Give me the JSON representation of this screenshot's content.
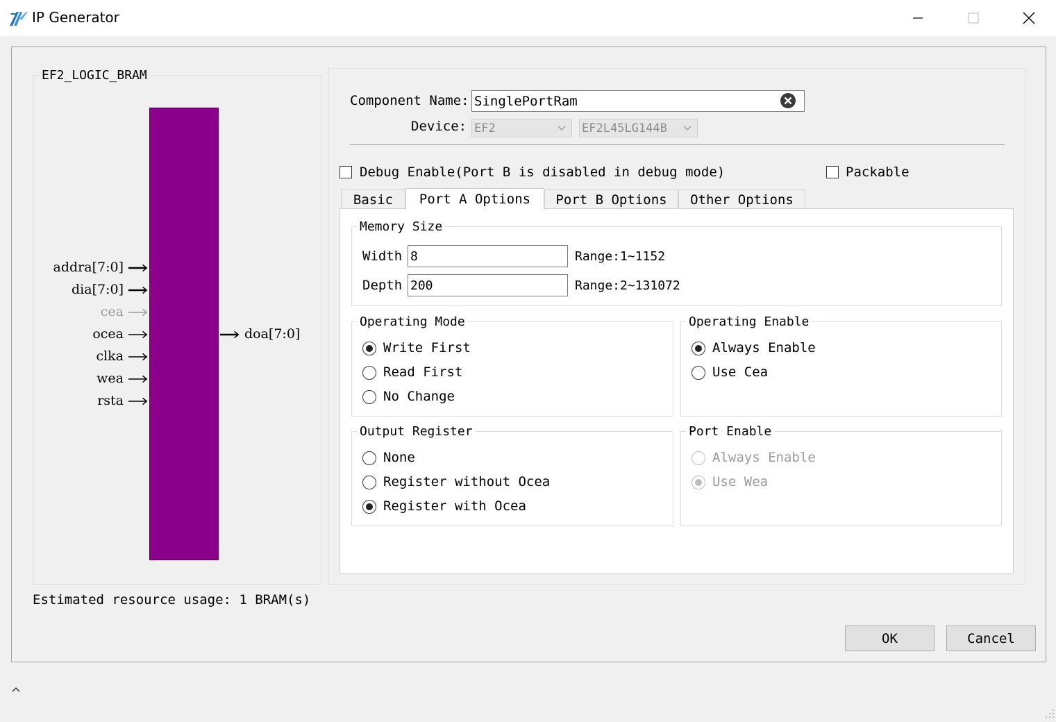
{
  "window": {
    "title": "IP Generator",
    "app_icon": "ip-generator-logo-icon"
  },
  "schematic": {
    "group_title": "EF2_LOGIC_BRAM",
    "block_color": "#8b008b",
    "inputs": [
      {
        "name": "addra[7:0]",
        "bus": true,
        "enabled": true
      },
      {
        "name": "dia[7:0]",
        "bus": true,
        "enabled": true
      },
      {
        "name": "cea",
        "bus": false,
        "enabled": false
      },
      {
        "name": "ocea",
        "bus": false,
        "enabled": true
      },
      {
        "name": "clka",
        "bus": false,
        "enabled": true
      },
      {
        "name": "wea",
        "bus": false,
        "enabled": true
      },
      {
        "name": "rsta",
        "bus": false,
        "enabled": true
      }
    ],
    "outputs": [
      {
        "name": "doa[7:0]",
        "bus": true
      }
    ],
    "resource_usage": "Estimated resource usage: 1 BRAM(s)"
  },
  "config": {
    "component_name_label": "Component Name:",
    "component_name_value": "SinglePortRam",
    "device_label": "Device:",
    "device_family": "EF2",
    "device_part": "EF2L45LG144B",
    "debug_enable_label": "Debug Enable(Port B is disabled in debug mode)",
    "debug_enable_checked": false,
    "packable_label": "Packable",
    "packable_checked": false
  },
  "tabs": [
    {
      "label": "Basic",
      "active": false
    },
    {
      "label": "Port A Options",
      "active": true
    },
    {
      "label": "Port B Options",
      "active": false
    },
    {
      "label": "Other Options",
      "active": false
    }
  ],
  "memory_size": {
    "title": "Memory Size",
    "width_label": "Width",
    "width_value": "8",
    "width_range": "Range:1~1152",
    "depth_label": "Depth",
    "depth_value": "200",
    "depth_range": "Range:2~131072"
  },
  "operating_mode": {
    "title": "Operating Mode",
    "options": [
      {
        "label": "Write First",
        "checked": true
      },
      {
        "label": "Read First",
        "checked": false
      },
      {
        "label": "No Change",
        "checked": false
      }
    ]
  },
  "operating_enable": {
    "title": "Operating Enable",
    "options": [
      {
        "label": "Always Enable",
        "checked": true
      },
      {
        "label": "Use Cea",
        "checked": false
      }
    ]
  },
  "output_register": {
    "title": "Output Register",
    "options": [
      {
        "label": "None",
        "checked": false
      },
      {
        "label": "Register without Ocea",
        "checked": false
      },
      {
        "label": "Register with Ocea",
        "checked": true
      }
    ]
  },
  "port_enable": {
    "title": "Port Enable",
    "disabled": true,
    "options": [
      {
        "label": "Always Enable",
        "checked": false
      },
      {
        "label": "Use Wea",
        "checked": true
      }
    ]
  },
  "buttons": {
    "ok": "OK",
    "cancel": "Cancel"
  }
}
